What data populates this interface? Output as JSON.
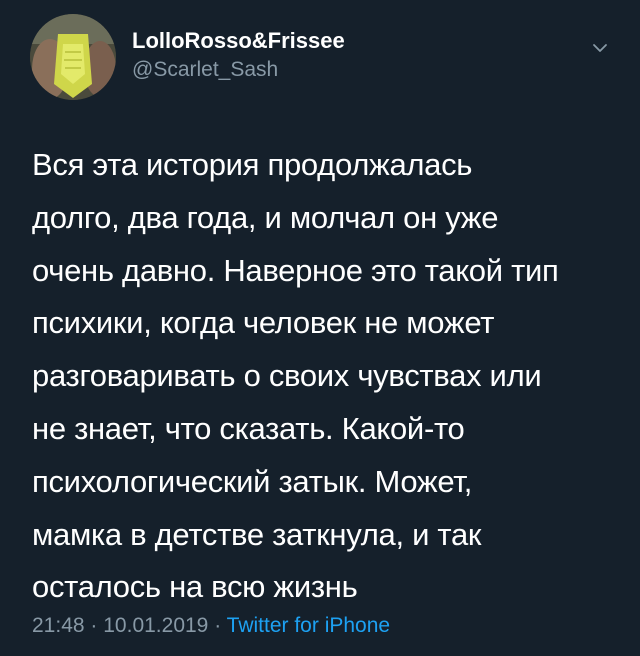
{
  "tweet": {
    "author": {
      "display_name": "LolloRosso&Frissee",
      "handle": "@Scarlet_Sash",
      "avatar_icon": "profile-photo"
    },
    "more_icon": "chevron-down-icon",
    "text_lines": [
      "Вся эта история продолжалась",
      "долго, два года, и молчал он уже",
      "очень давно. Наверное это такой тип",
      "психики, когда человек не может",
      "разговаривать о своих чувствах или",
      "не знает, что сказать. Какой-то",
      "психологический затык. Может,",
      "мамка в детстве заткнула, и так",
      "осталось на всю жизнь"
    ],
    "time": "21:48",
    "date": "10.01.2019",
    "separator": "·",
    "source": "Twitter for iPhone"
  },
  "colors": {
    "background": "#15202b",
    "text": "#ffffff",
    "secondary": "#8899a6",
    "link": "#1da1f2"
  }
}
